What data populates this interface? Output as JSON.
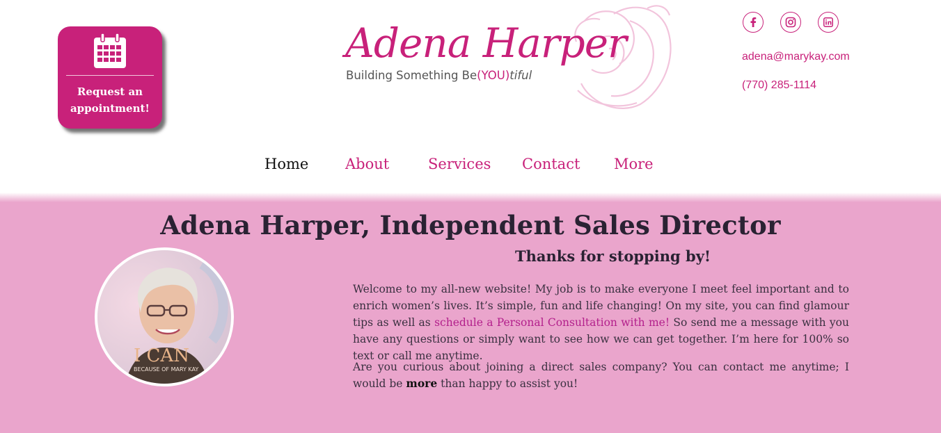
{
  "appointment": {
    "label_line1": "Request an",
    "label_line2": "appointment!",
    "icon": "calendar-icon"
  },
  "logo": {
    "brand": "Adena Harper",
    "tagline_prefix": "Building Something Be",
    "tagline_you": "(YOU)",
    "tagline_suffix": "tiful"
  },
  "social": [
    {
      "name": "facebook-icon",
      "glyph": "f"
    },
    {
      "name": "instagram-icon",
      "glyph": "◎"
    },
    {
      "name": "linkedin-icon",
      "glyph": "in"
    }
  ],
  "contact": {
    "email": "adena@marykay.com",
    "phone": "(770) 285-1114"
  },
  "nav": [
    {
      "label": "Home",
      "active": true
    },
    {
      "label": "About",
      "active": false
    },
    {
      "label": "Services",
      "active": false
    },
    {
      "label": "Contact",
      "active": false
    },
    {
      "label": "More",
      "active": false
    }
  ],
  "main": {
    "headline": "Adena Harper, Independent Sales Director",
    "subheading": "Thanks for stopping by!",
    "p1_before": "Welcome to my all-new website! My job is to make everyone I meet feel important and to enrich women’s lives. It’s simple, fun and life changing! On my site, you can find glamour tips as well as ",
    "p1_link": "schedule a Personal Consultation with me!",
    "p1_after": " So send me a message with you have any questions or simply want to see how we can get together. I’m here for 100% so text or call me anytime.",
    "p2_before": "Are you curious about joining a direct sales company? You can contact me anytime; I would be ",
    "p2_strong": "more",
    "p2_after": " than happy to assist you!",
    "photo_caption": "I CAN",
    "photo_caption_sub": "BECAUSE OF MARY KAY"
  },
  "colors": {
    "accent": "#c8217a",
    "band": "#eaa5cc",
    "link": "#b3208c"
  }
}
